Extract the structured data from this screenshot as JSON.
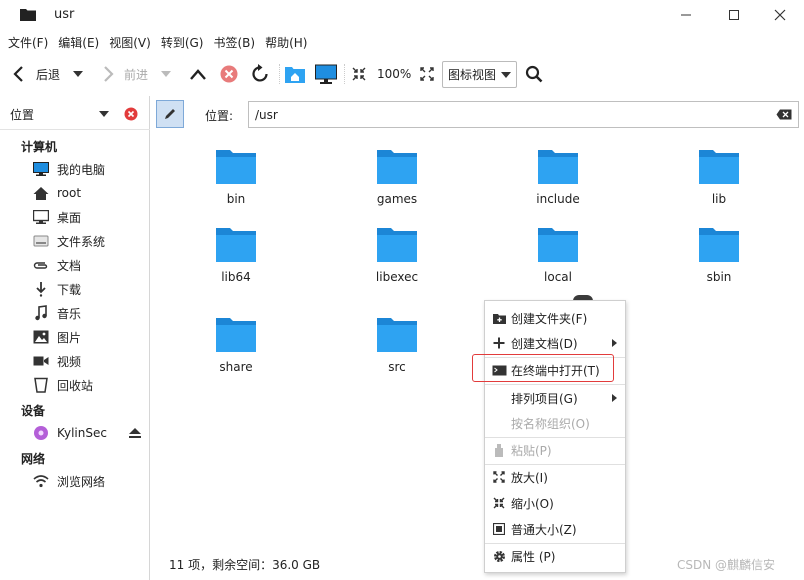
{
  "window": {
    "title": "usr"
  },
  "menubar": [
    "文件(F)",
    "编辑(E)",
    "视图(V)",
    "转到(G)",
    "书签(B)",
    "帮助(H)"
  ],
  "toolbar": {
    "back": "后退",
    "forward": "前进",
    "zoom": "100%",
    "view_mode": "图标视图"
  },
  "sidebar": {
    "header": "位置",
    "sections": [
      {
        "title": "计算机",
        "items": [
          {
            "label": "我的电脑",
            "icon": "monitor-icon"
          },
          {
            "label": "root",
            "icon": "home-icon"
          },
          {
            "label": "桌面",
            "icon": "desktop-icon"
          },
          {
            "label": "文件系统",
            "icon": "drive-icon"
          },
          {
            "label": "文档",
            "icon": "paperclip-icon"
          },
          {
            "label": "下载",
            "icon": "download-icon"
          },
          {
            "label": "音乐",
            "icon": "music-icon"
          },
          {
            "label": "图片",
            "icon": "picture-icon"
          },
          {
            "label": "视频",
            "icon": "video-icon"
          },
          {
            "label": "回收站",
            "icon": "trash-icon"
          }
        ]
      },
      {
        "title": "设备",
        "items": [
          {
            "label": "KylinSec",
            "icon": "disc-icon"
          }
        ]
      },
      {
        "title": "网络",
        "items": [
          {
            "label": "浏览网络",
            "icon": "wifi-icon"
          }
        ]
      }
    ]
  },
  "location": {
    "label": "位置:",
    "path": "/usr"
  },
  "files": [
    "bin",
    "games",
    "include",
    "lib",
    "lib64",
    "libexec",
    "local",
    "sbin",
    "share",
    "src"
  ],
  "status": "11 项，剩余空间：36.0 GB",
  "context_menu": {
    "create_folder": "创建文件夹(F)",
    "create_doc": "创建文档(D)",
    "open_terminal": "在终端中打开(T)",
    "arrange": "排列项目(G)",
    "organize_by_name": "按名称组织(O)",
    "paste": "粘贴(P)",
    "zoom_in": "放大(I)",
    "zoom_out": "缩小(O)",
    "normal_size": "普通大小(Z)",
    "properties": "属性 (P)"
  },
  "watermark": "CSDN @麒麟信安",
  "colors": {
    "folder": "#2ea3f2",
    "folder_dark": "#1c86d6",
    "highlight": "#e23b3b",
    "accent": "#cfe0f3"
  }
}
